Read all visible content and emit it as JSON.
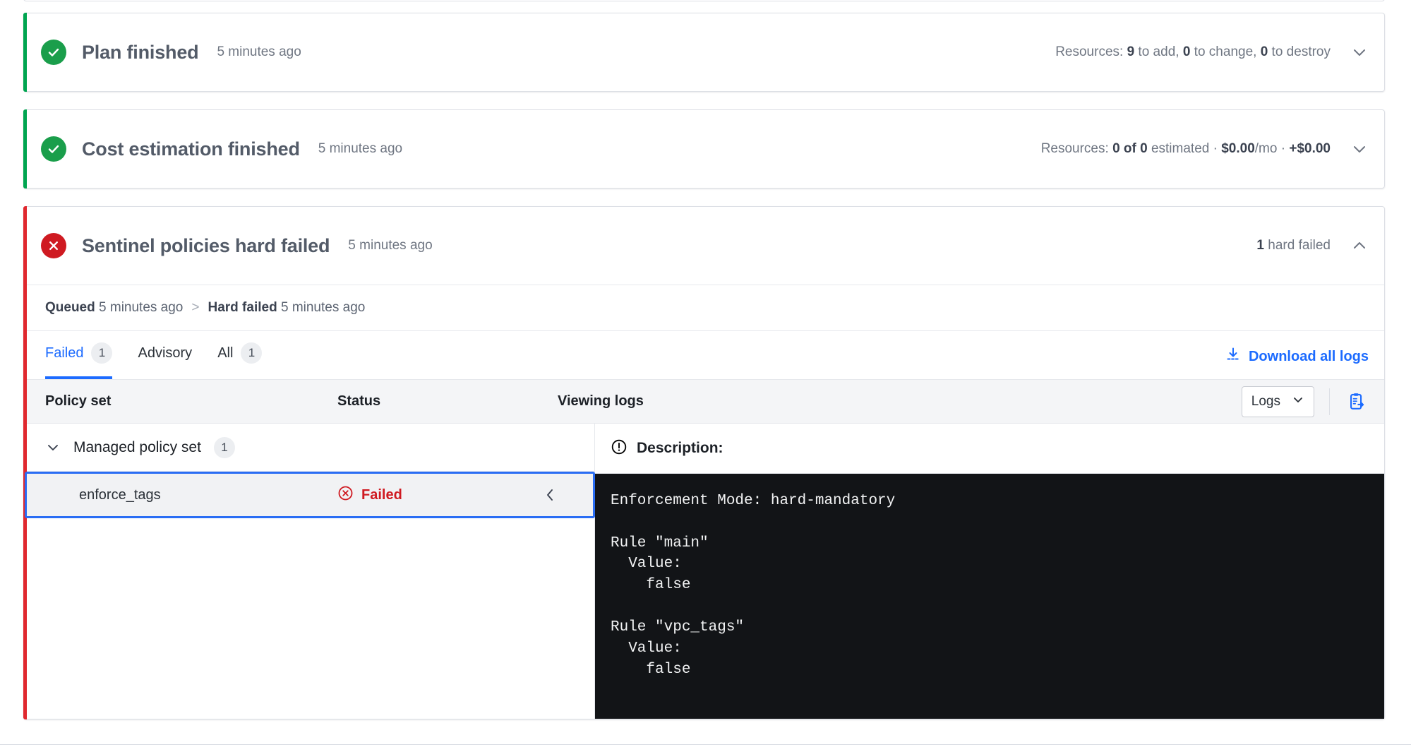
{
  "cards": {
    "plan": {
      "title": "Plan finished",
      "time": "5 minutes ago",
      "meta_prefix": "Resources: ",
      "meta_add": "9",
      "meta_add_label": " to add, ",
      "meta_change": "0",
      "meta_change_label": " to change, ",
      "meta_destroy": "0",
      "meta_destroy_label": " to destroy",
      "state": "ok",
      "expanded": false
    },
    "cost": {
      "title": "Cost estimation finished",
      "time": "5 minutes ago",
      "meta_prefix": "Resources: ",
      "meta_count": "0 of 0",
      "meta_estimated": " estimated · ",
      "meta_monthly": "$0.00",
      "meta_per": "/mo · ",
      "meta_delta": "+$0.00",
      "state": "ok",
      "expanded": false
    },
    "sentinel": {
      "title": "Sentinel policies hard failed",
      "time": "5 minutes ago",
      "meta_count": "1",
      "meta_label": " hard failed",
      "state": "failed",
      "expanded": true,
      "timeline": {
        "queued_label": "Queued",
        "queued_time": "5 minutes ago",
        "separator": ">",
        "failed_label": "Hard failed",
        "failed_time": "5 minutes ago"
      },
      "tabs": [
        {
          "label": "Failed",
          "count": "1",
          "active": true
        },
        {
          "label": "Advisory",
          "count": "",
          "active": false
        },
        {
          "label": "All",
          "count": "1",
          "active": false
        }
      ],
      "download_label": "Download all logs",
      "table": {
        "columns": {
          "policy_set": "Policy set",
          "status": "Status",
          "viewing_logs": "Viewing logs"
        },
        "logs_select_value": "Logs",
        "group": {
          "name": "Managed policy set",
          "count": "1"
        },
        "rows": [
          {
            "name": "enforce_tags",
            "status": "Failed",
            "selected": true
          }
        ]
      },
      "log_panel": {
        "description_label": "Description:",
        "log_text": "Enforcement Mode: hard-mandatory\n\nRule \"main\"\n  Value:\n    false\n\nRule \"vpc_tags\"\n  Value:\n    false"
      }
    }
  },
  "colors": {
    "success": "#1a9e4b",
    "error": "#cf1a21",
    "link": "#1c6bff",
    "terminal_bg": "#121417"
  }
}
